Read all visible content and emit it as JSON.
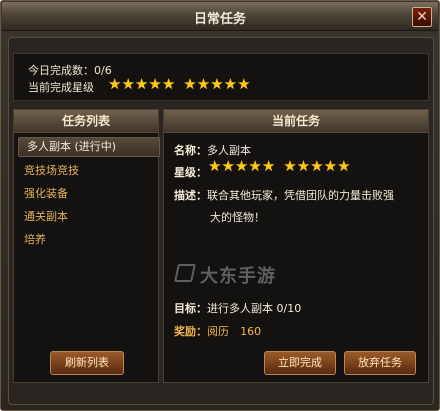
{
  "window": {
    "title": "日常任务",
    "close_icon": "close-icon"
  },
  "summary": {
    "completed_label": "今日完成数：",
    "completed_value": "0/6",
    "stars_label": "当前完成星级",
    "stars": {
      "filled": 10,
      "total": 10
    }
  },
  "task_list": {
    "header": "任务列表",
    "items": [
      "多人副本 (进行中)",
      "竞技场竞技",
      "强化装备",
      "通关副本",
      "培养"
    ],
    "selected_index": 0,
    "refresh_button": "刷新列表"
  },
  "current_task": {
    "header": "当前任务",
    "name_label": "名称：",
    "name_value": "多人副本",
    "stars_label": "星级：",
    "stars": {
      "filled": 10,
      "total": 10
    },
    "desc_label": "描述：",
    "desc_lines": [
      "联合其他玩家，凭借团队的力量击败强",
      "大的怪物！"
    ],
    "goal_label": "目标：",
    "goal_value": "进行多人副本  0/10",
    "reward_label": "奖励：",
    "reward_name": "阅历",
    "reward_value": "160",
    "complete_button": "立即完成",
    "abandon_button": "放弃任务"
  },
  "watermark": "大东手游",
  "colors": {
    "accent_gold": "#f0b54b",
    "star": "#ffc81a",
    "button": "#9a5a2a"
  }
}
